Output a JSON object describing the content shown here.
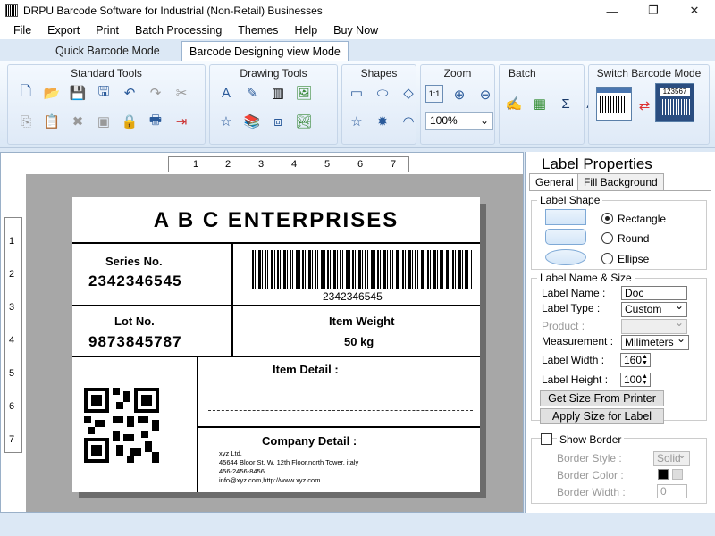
{
  "window": {
    "title": "DRPU Barcode Software for Industrial (Non-Retail) Businesses",
    "min_glyph": "—",
    "max_glyph": "❐",
    "close_glyph": "✕"
  },
  "menu": [
    "File",
    "Export",
    "Print",
    "Batch Processing",
    "Themes",
    "Help",
    "Buy Now"
  ],
  "mode_tabs": {
    "quick": "Quick Barcode Mode",
    "designing": "Barcode Designing view Mode"
  },
  "ribbon": {
    "standard_tools": "Standard Tools",
    "drawing_tools": "Drawing Tools",
    "shapes": "Shapes",
    "zoom": "Zoom",
    "zoom_fit": "1:1",
    "zoom_value": "100%",
    "batch": "Batch",
    "switch_mode": "Switch Barcode Mode",
    "switch_number": "123567"
  },
  "ruler": {
    "top": [
      "1",
      "2",
      "3",
      "4",
      "5",
      "6",
      "7"
    ],
    "left": [
      "1",
      "2",
      "3",
      "4",
      "5",
      "6",
      "7"
    ]
  },
  "label": {
    "company": "A B C ENTERPRISES",
    "series_caption": "Series No.",
    "series_value": "2342346545",
    "barcode_text": "2342346545",
    "lot_caption": "Lot No.",
    "lot_value": "9873845787",
    "weight_caption": "Item Weight",
    "weight_value": "50 kg",
    "item_detail": "Item Detail :",
    "company_detail": "Company Detail :",
    "address": [
      "xyz Ltd.",
      "45644 Bloor St. W. 12th Floor,north Tower, italy",
      "456-2456-8456",
      "info@xyz.com,http://www.xyz.com"
    ]
  },
  "props": {
    "title": "Label Properties",
    "tab_general": "General",
    "tab_fill": "Fill Background",
    "shape_legend": "Label Shape",
    "shape_options": [
      "Rectangle",
      "Round",
      "Ellipse"
    ],
    "shape_selected": "Rectangle",
    "name_size_legend": "Label  Name & Size",
    "label_name_caption": "Label Name :",
    "label_name_value": "Doc",
    "label_type_caption": "Label Type :",
    "label_type_value": "Custom",
    "product_caption": "Product :",
    "product_value": "",
    "measurement_caption": "Measurement :",
    "measurement_value": "Milimeters",
    "width_caption": "Label Width :",
    "width_value": "160",
    "height_caption": "Label Height :",
    "height_value": "100",
    "get_size_btn": "Get Size From Printer",
    "apply_size_btn": "Apply Size for Label",
    "show_border": "Show Border",
    "border_style_caption": "Border Style :",
    "border_style_value": "Solid",
    "border_color_caption": "Border Color :",
    "border_width_caption": "Border Width :",
    "border_width_value": "0"
  },
  "colors": {
    "accent": "#2a5a9a",
    "ribbon_bg": "#dce8f5"
  }
}
